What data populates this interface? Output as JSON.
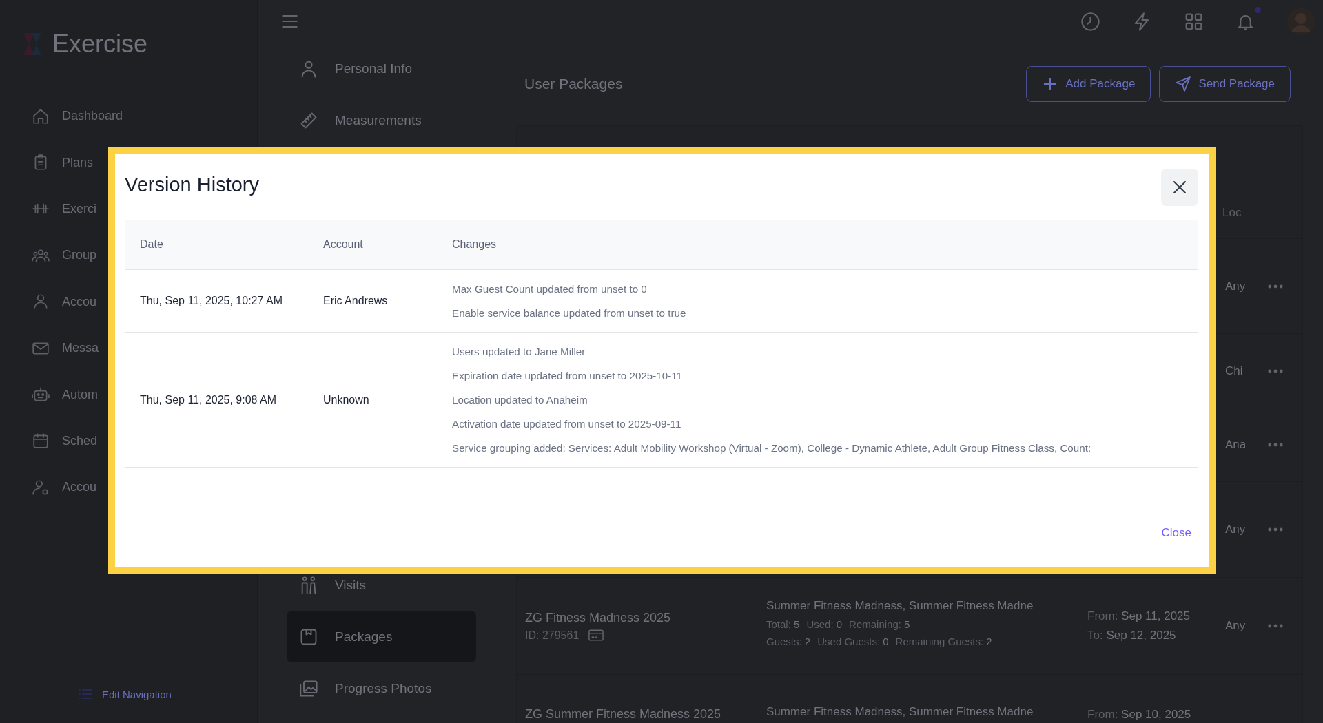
{
  "sidebar": {
    "logo": "Exercise",
    "items": [
      {
        "label": "Dashboard"
      },
      {
        "label": "Plans"
      },
      {
        "label": "Exerci"
      },
      {
        "label": "Group"
      },
      {
        "label": "Accou"
      },
      {
        "label": "Messa"
      },
      {
        "label": "Autom"
      },
      {
        "label": "Sched"
      },
      {
        "label": "Accou"
      }
    ],
    "edit_navigation": "Edit Navigation"
  },
  "header": {
    "notifications_unread": true
  },
  "profile_menu": {
    "top_items": [
      {
        "label": "Personal Info",
        "selected": false
      },
      {
        "label": "Measurements",
        "selected": false
      }
    ],
    "bottom_items": [
      {
        "label": "Visits",
        "selected": false
      },
      {
        "label": "Packages",
        "selected": true
      },
      {
        "label": "Progress Photos",
        "selected": false
      }
    ]
  },
  "main": {
    "title": "User Packages",
    "buttons": [
      {
        "label": "Add Package",
        "kind": "add"
      },
      {
        "label": "Send Package",
        "kind": "send"
      }
    ],
    "table": {
      "column_heading": "Loc",
      "rows": [
        {
          "location": "Any"
        },
        {
          "location": "Chi"
        },
        {
          "location": "Ana"
        },
        {
          "location": "Any"
        },
        {
          "name": "ZG Fitness Madness 2025",
          "id": "ID: 279561",
          "services": "Summer Fitness Madness, Summer Fitness Madne",
          "stats": [
            [
              {
                "label": "Total:",
                "value": "5"
              },
              {
                "label": "Used:",
                "value": "0"
              },
              {
                "label": "Remaining:",
                "value": "5"
              }
            ],
            [
              {
                "label": "Guests:",
                "value": "2"
              },
              {
                "label": "Used Guests:",
                "value": "0"
              },
              {
                "label": "Remaining Guests:",
                "value": "2"
              }
            ]
          ],
          "dates": [
            {
              "label": "From:",
              "value": "Sep 11, 2025"
            },
            {
              "label": "To:",
              "value": "Sep 12, 2025"
            }
          ],
          "location": "Any"
        },
        {
          "name": "ZG Summer Fitness Madness 2025",
          "services": "Summer Fitness Madness, Summer Fitness Madne",
          "dates": [
            {
              "label": "From:",
              "value": "Sep 10, 2025"
            }
          ]
        }
      ]
    }
  },
  "modal": {
    "title": "Version History",
    "columns": [
      "Date",
      "Account",
      "Changes"
    ],
    "rows": [
      {
        "date": "Thu, Sep 11, 2025, 10:27 AM",
        "account": "Eric Andrews",
        "changes": [
          "Max Guest Count updated from unset to 0",
          "Enable service balance updated from unset to true"
        ]
      },
      {
        "date": "Thu, Sep 11, 2025, 9:08 AM",
        "account": "Unknown",
        "changes": [
          "Users updated to Jane Miller",
          "Expiration date updated from unset to 2025-10-11",
          "Location updated to Anaheim",
          "Activation date updated from unset to 2025-09-11",
          "Service grouping added: Services: Adult Mobility Workshop (Virtual - Zoom), College - Dynamic Athlete, Adult Group Fitness Class, Count:"
        ]
      }
    ],
    "close_label": "Close"
  }
}
